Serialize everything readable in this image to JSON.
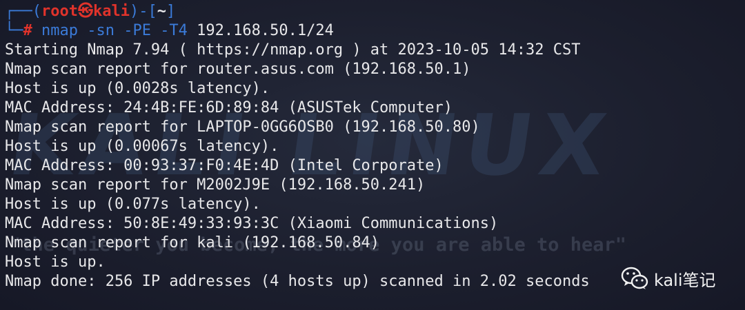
{
  "wallpaper": {
    "title": "KALI LINUX",
    "tagline": "\"the quieter you become, the more you are able to hear\""
  },
  "prompt": {
    "frame_top_left": "┌──(",
    "user": "root",
    "skull": "㉿",
    "host": "kali",
    "frame_mid": ")-[",
    "path": "~",
    "frame_close": "]",
    "frame_bottom": "└─",
    "hash": "#"
  },
  "command": {
    "name": "nmap",
    "args": " -sn -PE -T4",
    "target": " 192.168.50.1/24"
  },
  "output": [
    "Starting Nmap 7.94 ( https://nmap.org ) at 2023-10-05 14:32 CST",
    "Nmap scan report for router.asus.com (192.168.50.1)",
    "Host is up (0.0028s latency).",
    "MAC Address: 24:4B:FE:6D:89:84 (ASUSTek Computer)",
    "Nmap scan report for LAPTOP-0GG6OSB0 (192.168.50.80)",
    "Host is up (0.00067s latency).",
    "MAC Address: 00:93:37:F0:4E:4D (Intel Corporate)",
    "Nmap scan report for M2002J9E (192.168.50.241)",
    "Host is up (0.077s latency).",
    "MAC Address: 50:8E:49:33:93:3C (Xiaomi Communications)",
    "Nmap scan report for kali (192.168.50.84)",
    "Host is up.",
    "Nmap done: 256 IP addresses (4 hosts up) scanned in 2.02 seconds"
  ],
  "brand": {
    "icon": "wechat-icon",
    "label": "kali笔记"
  },
  "colors": {
    "background": "#1c1f2e",
    "prompt_blue": "#3b7bd9",
    "prompt_red": "#e0332b",
    "text": "#e8e8ea"
  }
}
